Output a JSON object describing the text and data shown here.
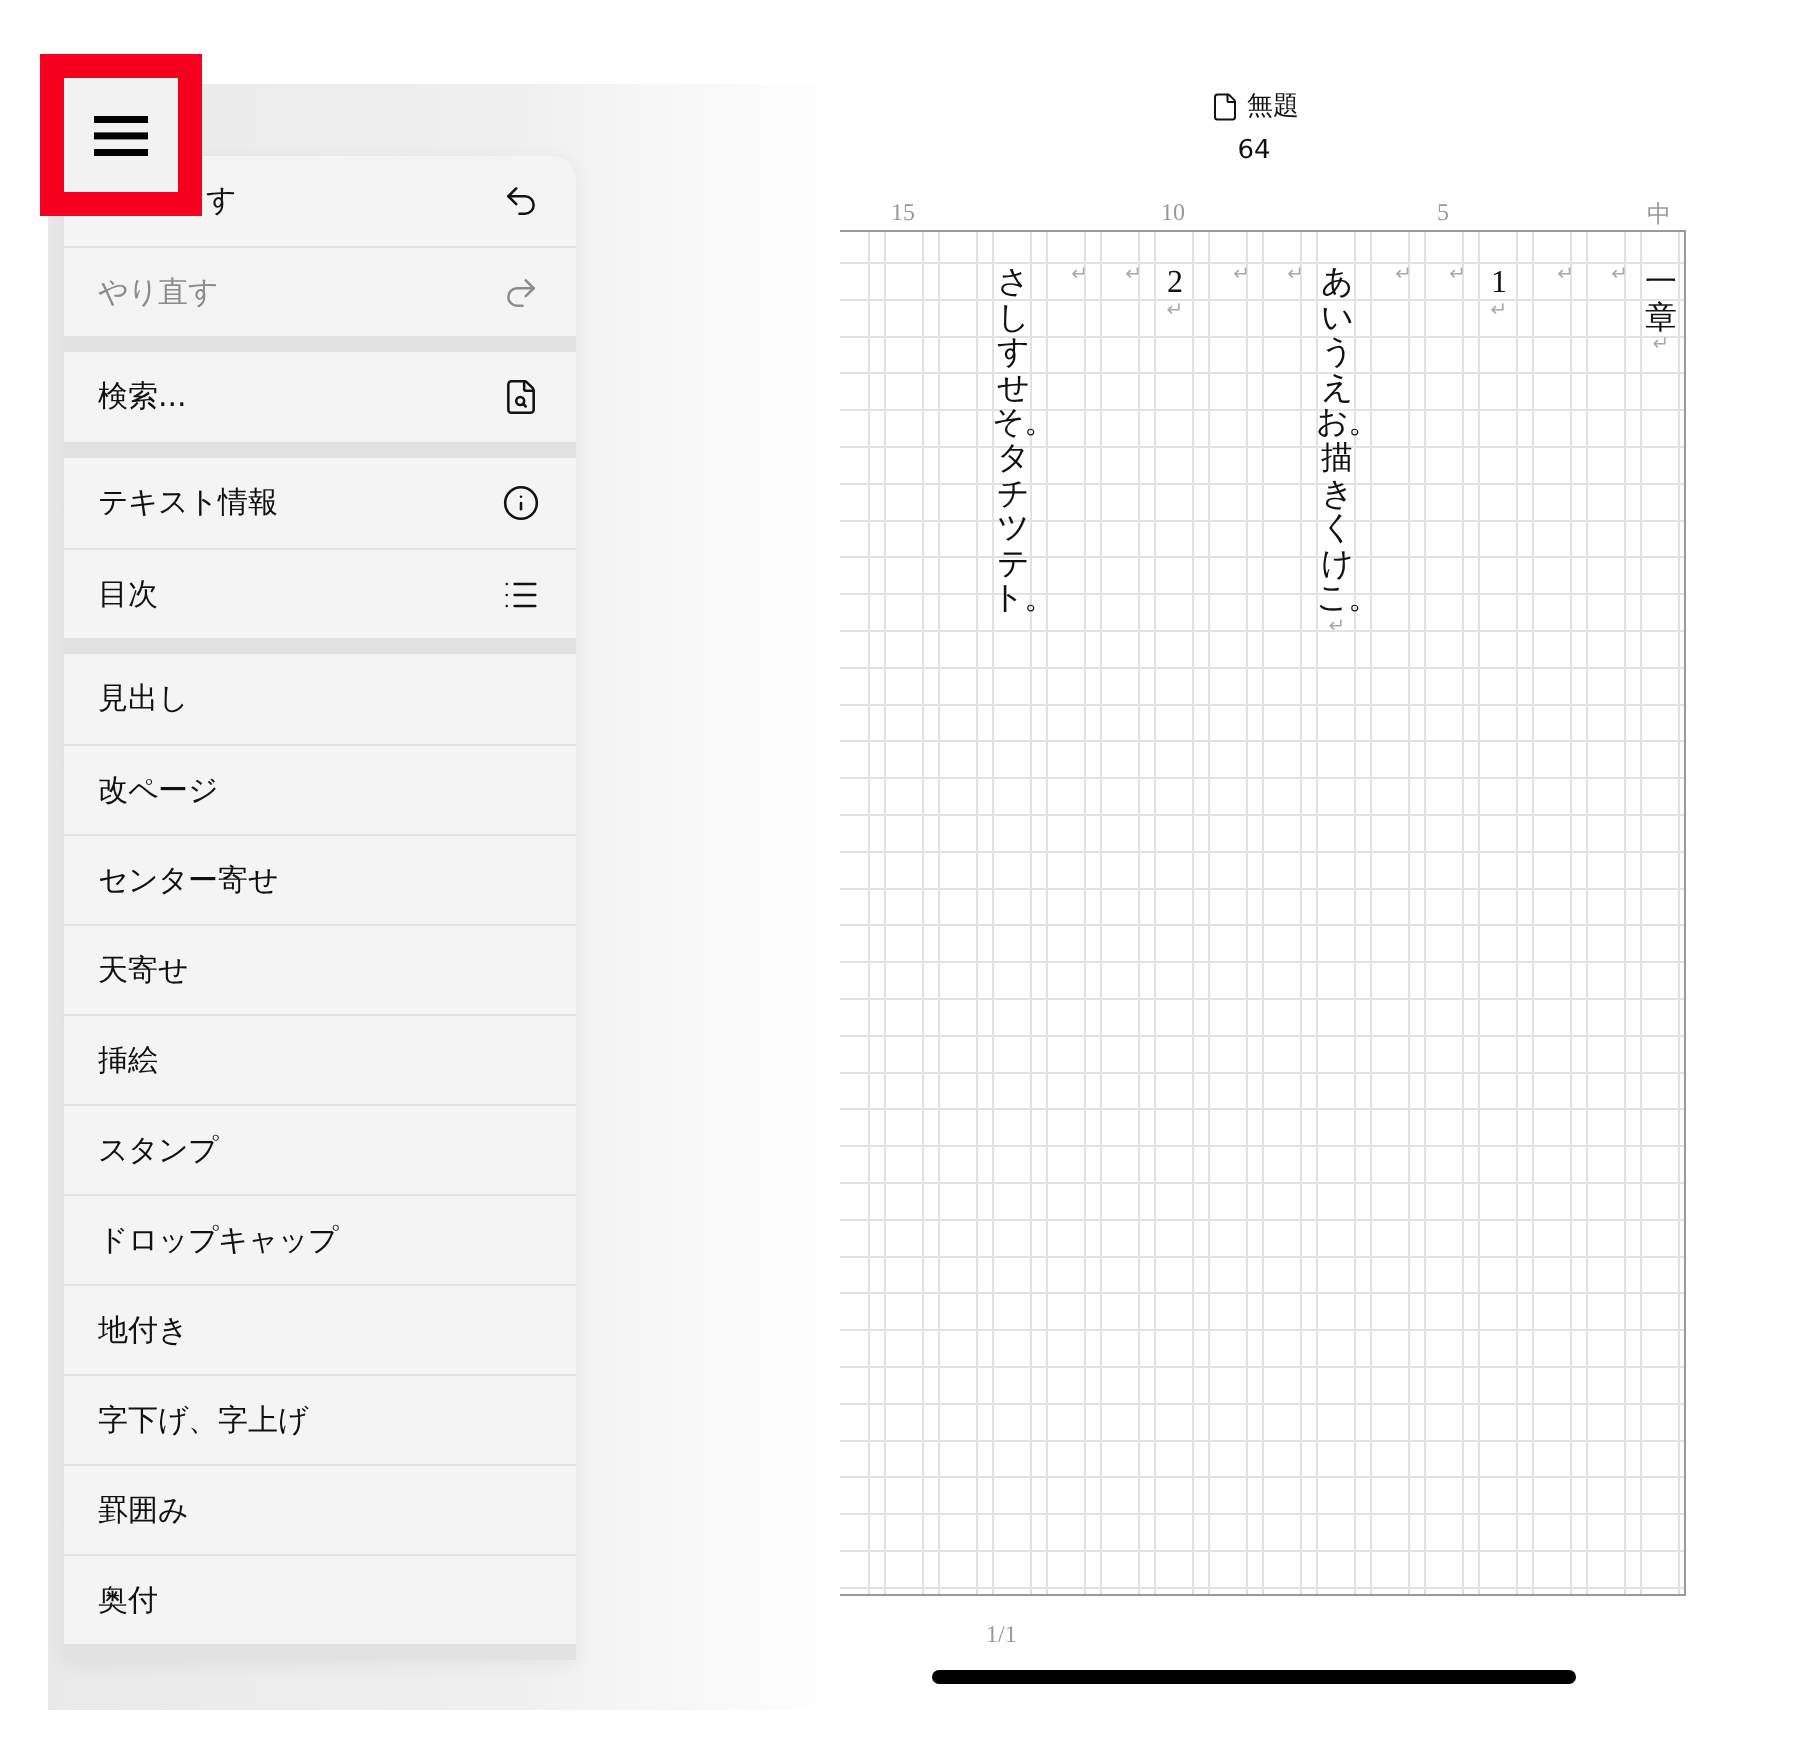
{
  "menu_button": {
    "highlighted": true
  },
  "menu": {
    "groups": [
      [
        {
          "label": "す",
          "disabled": false
        },
        {
          "label": "やり直す",
          "disabled": true
        }
      ],
      [
        {
          "label": "検索...",
          "disabled": false
        }
      ],
      [
        {
          "label": "テキスト情報",
          "disabled": false
        },
        {
          "label": "目次",
          "disabled": false
        }
      ],
      [
        {
          "label": "見出し",
          "disabled": false
        },
        {
          "label": "改ページ",
          "disabled": false
        },
        {
          "label": "センター寄せ",
          "disabled": false
        },
        {
          "label": "天寄せ",
          "disabled": false
        },
        {
          "label": "挿絵",
          "disabled": false
        },
        {
          "label": "スタンプ",
          "disabled": false
        },
        {
          "label": "ドロップキャップ",
          "disabled": false
        },
        {
          "label": "地付き",
          "disabled": false
        },
        {
          "label": "字下げ、字上げ",
          "disabled": false
        },
        {
          "label": "罫囲み",
          "disabled": false
        },
        {
          "label": "奥付",
          "disabled": false
        }
      ]
    ]
  },
  "document": {
    "title": "無題",
    "char_count": "64"
  },
  "ruler": [
    "15",
    "10",
    "5",
    "中"
  ],
  "columns": [
    {},
    {},
    {},
    {
      "text": "さしすせそ。タチツテト。"
    },
    {
      "mark": "↵"
    },
    {
      "mark": "↵"
    },
    {
      "text": "2",
      "mark": "↵"
    },
    {
      "mark": "↵"
    },
    {
      "mark": "↵"
    },
    {
      "text": "あいうえお。描きくけこ。",
      "mark": "↵"
    },
    {
      "mark": "↵"
    },
    {
      "mark": "↵"
    },
    {
      "text": "1",
      "mark": "↵"
    },
    {
      "mark": "↵"
    },
    {
      "mark": "↵"
    },
    {
      "text": "一章",
      "mark": "↵"
    }
  ],
  "page_indicator": "1/1"
}
